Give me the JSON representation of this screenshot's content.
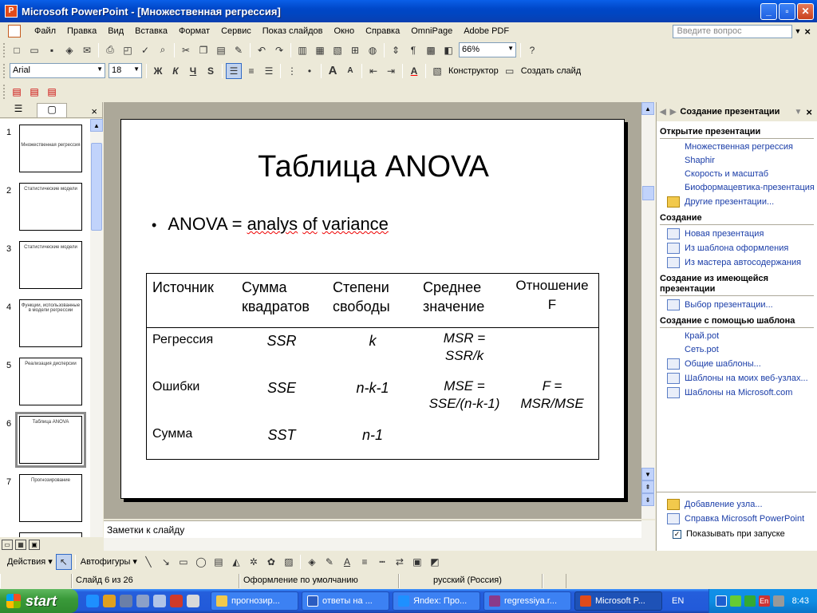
{
  "window": {
    "title": "Microsoft PowerPoint - [Множественная регрессия]",
    "minimize": "_",
    "maximize": "▫",
    "close": "✕"
  },
  "menu": {
    "items": [
      "Файл",
      "Правка",
      "Вид",
      "Вставка",
      "Формат",
      "Сервис",
      "Показ слайдов",
      "Окно",
      "Справка",
      "OmniPage",
      "Adobe PDF"
    ],
    "ask_placeholder": "Введите вопрос"
  },
  "toolbar": {
    "zoom": "66%",
    "font": "Arial",
    "font_size": "18",
    "bold": "Ж",
    "italic": "К",
    "underline": "Ч",
    "shadow": "S",
    "designer": "Конструктор",
    "new_slide": "Создать слайд"
  },
  "thumbnails": [
    {
      "num": "1",
      "caption": "Множественная регрессия"
    },
    {
      "num": "2",
      "caption": "Статистические модели"
    },
    {
      "num": "3",
      "caption": "Статистические модели"
    },
    {
      "num": "4",
      "caption": "Функции, использованные в модели регрессии"
    },
    {
      "num": "5",
      "caption": "Реализация дисперсии"
    },
    {
      "num": "6",
      "caption": "Таблица ANOVA"
    },
    {
      "num": "7",
      "caption": "Прогнозирование"
    }
  ],
  "slide": {
    "title": "Таблица ANOVA",
    "bullet_prefix": "ANOVA = ",
    "bullet_w1": "analys",
    "bullet_w2": "of",
    "bullet_w3": "variance",
    "headers": {
      "source": "Источник",
      "ss_1": "Сумма",
      "ss_2": "квадратов",
      "df_1": "Степени",
      "df_2": "свободы",
      "ms_1": "Среднее",
      "ms_2": "значение",
      "f_1": "Отношение",
      "f_2": "F"
    },
    "rows": [
      {
        "source": "Регрессия",
        "ss": "SSR",
        "df": "k",
        "ms_1": "MSR =",
        "ms_2": "SSR/k",
        "f_1": "",
        "f_2": ""
      },
      {
        "source": "Ошибки",
        "ss": "SSE",
        "df": "n-k-1",
        "ms_1": "MSE =",
        "ms_2": "SSE/(n-k-1)",
        "f_1": "F =",
        "f_2": "MSR/MSE"
      },
      {
        "source": "Сумма",
        "ss": "SST",
        "df": "n-1",
        "ms_1": "",
        "ms_2": "",
        "f_1": "",
        "f_2": ""
      }
    ]
  },
  "notes_placeholder": "Заметки к слайду",
  "taskpane": {
    "title": "Создание презентации",
    "sec_open": "Открытие презентации",
    "recent": [
      "Множественная регрессия",
      "Shaphir",
      "Скорость и масштаб",
      "Биоформацевтика-презентация"
    ],
    "other": "Другие презентации...",
    "sec_create": "Создание",
    "create_items": [
      "Новая презентация",
      "Из шаблона оформления",
      "Из мастера автосодержания"
    ],
    "sec_existing": "Создание из имеющейся презентации",
    "choose": "Выбор презентации...",
    "sec_template": "Создание с помощью шаблона",
    "templates": [
      "Край.pot",
      "Сеть.pot"
    ],
    "template_links": [
      "Общие шаблоны...",
      "Шаблоны на моих веб-узлах...",
      "Шаблоны на Microsoft.com"
    ],
    "add_node": "Добавление узла...",
    "help": "Справка Microsoft PowerPoint",
    "show_startup": "Показывать при запуске"
  },
  "drawbar": {
    "actions": "Действия",
    "autoshapes": "Автофигуры"
  },
  "status": {
    "slide": "Слайд 6 из 26",
    "design": "Оформление по умолчанию",
    "lang": "русский (Россия)"
  },
  "taskbar": {
    "start": "start",
    "tasks": [
      "прогнозир...",
      "ответы на ...",
      "Яndex: Про...",
      "regressiya.r...",
      "Microsoft P..."
    ],
    "lang": "EN",
    "tray_lang": "En",
    "clock": "8:43"
  }
}
